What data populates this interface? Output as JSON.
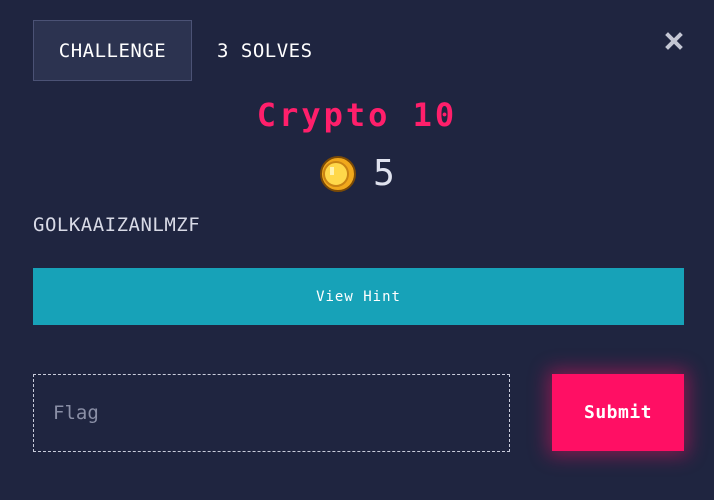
{
  "tabs": [
    {
      "label": "CHALLENGE",
      "active": true
    },
    {
      "label": "3 SOLVES",
      "active": false
    }
  ],
  "close_icon": "close-icon",
  "challenge": {
    "title": "Crypto 10",
    "value": "5",
    "value_icon": "coin-icon",
    "description": "GOLKAAIZANLMZF"
  },
  "hint": {
    "label": "View Hint"
  },
  "flag": {
    "placeholder": "Flag",
    "value": ""
  },
  "submit": {
    "label": "Submit"
  },
  "colors": {
    "background": "#1f2540",
    "title": "#ff1f6b",
    "hint_button": "#17a2b8",
    "submit_button": "#ff0f64"
  }
}
